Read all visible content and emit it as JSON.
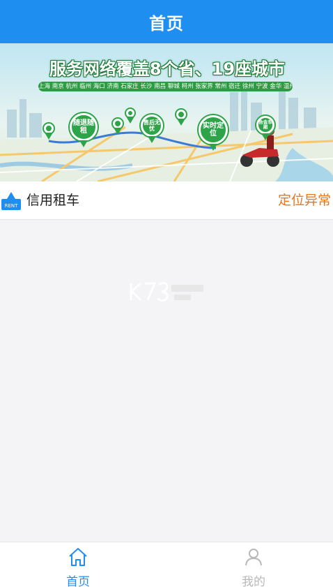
{
  "header": {
    "title": "首页"
  },
  "banner": {
    "headline": "服务网络覆盖8个省、19座城市",
    "cities": "上海 南京 杭州 临州 海口 济南 石家庄 长沙 南昌 聊城 柯州 张家界 常州 宿迁 徐州 宁波 金华 温州 义乌",
    "pins": {
      "return": "随退随租",
      "aftersales": "售后无忧",
      "locate": "实时定位",
      "alloy": "合金车厢"
    },
    "carousel": {
      "count": 3,
      "active_index": 2
    }
  },
  "rent": {
    "icon_label": "RENT",
    "title": "信用租车",
    "status": "定位异常"
  },
  "tabbar": {
    "tabs": [
      {
        "label": "首页",
        "icon": "home-icon",
        "active": true
      },
      {
        "label": "我的",
        "icon": "user-icon",
        "active": false
      }
    ]
  },
  "colors": {
    "primary": "#1e8ef0",
    "status_orange": "#e7761f",
    "banner_green": "#2ea44a",
    "inactive_gray": "#b8b8b8"
  }
}
